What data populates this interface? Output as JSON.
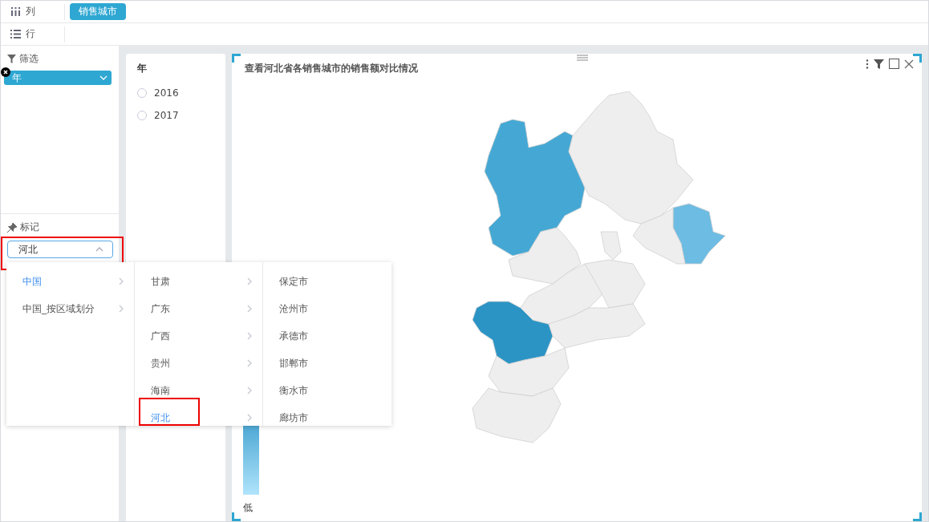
{
  "shelves": [
    {
      "kind": "columns",
      "label": "列",
      "pills": [
        "销售城市"
      ]
    },
    {
      "kind": "rows",
      "label": "行"
    }
  ],
  "filter_panel": {
    "title": "筛选",
    "pills": [
      {
        "label": "年"
      }
    ]
  },
  "mark_panel": {
    "title": "标记",
    "select": {
      "value": "河北",
      "expanded": true
    }
  },
  "cascader": {
    "columns": [
      [
        {
          "label": "中国",
          "selected": true,
          "has_children": true
        },
        {
          "label": "中国_按区域划分",
          "selected": false,
          "has_children": true
        }
      ],
      [
        {
          "label": "甘肃",
          "selected": false,
          "has_children": true
        },
        {
          "label": "广东",
          "selected": false,
          "has_children": true
        },
        {
          "label": "广西",
          "selected": false,
          "has_children": true
        },
        {
          "label": "贵州",
          "selected": false,
          "has_children": true
        },
        {
          "label": "海南",
          "selected": false,
          "has_children": true
        },
        {
          "label": "河北",
          "selected": true,
          "has_children": true
        }
      ],
      [
        {
          "label": "保定市",
          "selected": false
        },
        {
          "label": "沧州市",
          "selected": false
        },
        {
          "label": "承德市",
          "selected": false
        },
        {
          "label": "邯郸市",
          "selected": false
        },
        {
          "label": "衡水市",
          "selected": false
        },
        {
          "label": "廊坊市",
          "selected": false
        }
      ]
    ]
  },
  "year_filter": {
    "title": "年",
    "options": [
      {
        "label": "2016",
        "selected": false
      },
      {
        "label": "2017",
        "selected": false
      }
    ]
  },
  "chart": {
    "title": "查看河北省各销售城市的销售额对比情况",
    "legend": {
      "low_label": "低"
    }
  }
}
